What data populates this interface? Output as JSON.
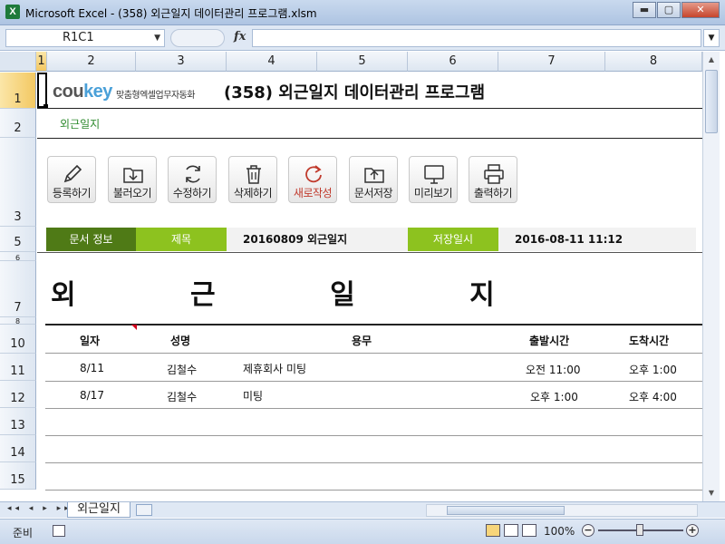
{
  "window": {
    "icon_letter": "X",
    "title": "Microsoft Excel - (358) 외근일지 데이터관리 프로그램.xlsm",
    "min_glyph": "▬",
    "max_glyph": "▢",
    "close_glyph": "✕"
  },
  "formula_bar": {
    "name_box": "R1C1",
    "fx_label": "fx",
    "content": ""
  },
  "columns": [
    "1",
    "2",
    "3",
    "4",
    "5",
    "6",
    "7",
    "8"
  ],
  "rows": [
    "1",
    "2",
    "3",
    "5",
    "6",
    "7",
    "8",
    "10",
    "11",
    "12",
    "13",
    "14",
    "15"
  ],
  "header": {
    "logo_main": "cou",
    "logo_key": "key",
    "logo_sub": "맞춤형엑셀업무자동화",
    "app_title": "(358) 외근일지 데이터관리 프로그램",
    "sheet_label": "외근일지"
  },
  "toolbar": [
    {
      "label": "등록하기",
      "icon": "pencil-icon"
    },
    {
      "label": "불러오기",
      "icon": "download-folder-icon"
    },
    {
      "label": "수정하기",
      "icon": "refresh-icon"
    },
    {
      "label": "삭제하기",
      "icon": "trash-icon"
    },
    {
      "label": "새로작성",
      "icon": "new-cycle-icon"
    },
    {
      "label": "문서저장",
      "icon": "upload-folder-icon"
    },
    {
      "label": "미리보기",
      "icon": "monitor-icon"
    },
    {
      "label": "출력하기",
      "icon": "printer-icon"
    }
  ],
  "doc_info": {
    "section_label": "문서 정보",
    "title_label": "제목",
    "title_value": "20160809 외근일지",
    "saved_label": "저장일시",
    "saved_value": "2016-08-11 11:12"
  },
  "big_title": "외 근 일 지",
  "table": {
    "headers": [
      "일자",
      "성명",
      "용무",
      "출발시간",
      "도착시간"
    ],
    "rows": [
      [
        "8/11",
        "김철수",
        "제휴회사 미팅",
        "오전 11:00",
        "오후 1:00"
      ],
      [
        "8/17",
        "김철수",
        "미팅",
        "오후 1:00",
        "오후 4:00"
      ]
    ]
  },
  "sheet_tabs": {
    "nav": "◂◂ ◂ ▸ ▸▸",
    "active": "외근일지"
  },
  "status": {
    "ready": "준비",
    "zoom": "100%",
    "zoom_minus": "−",
    "zoom_plus": "+"
  },
  "colors": {
    "info_dark": "#4f7a16",
    "info_green": "#8dc21f",
    "accent_red": "#c0392b",
    "sheet_label_green": "#2e8b2e"
  }
}
